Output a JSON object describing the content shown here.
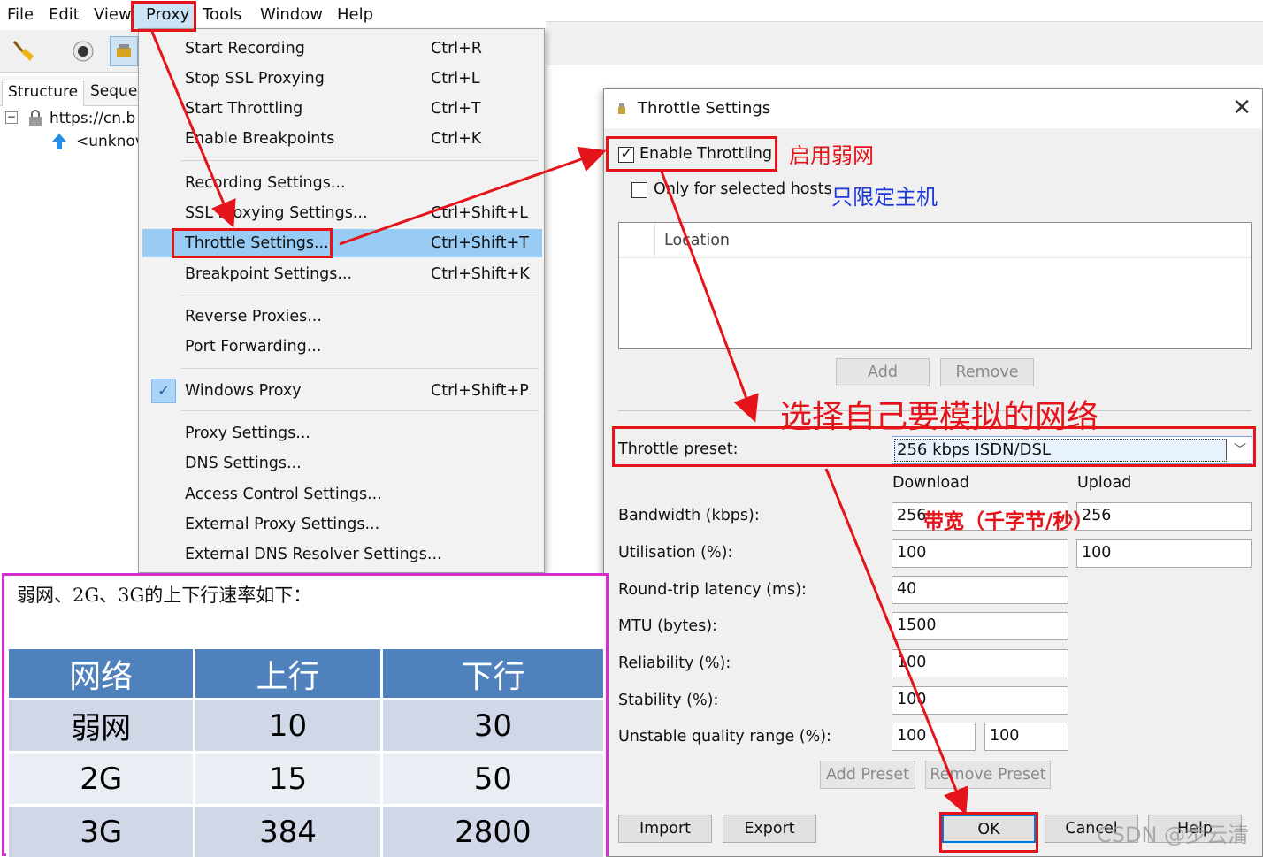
{
  "menubar": {
    "items": [
      "File",
      "Edit",
      "View",
      "Proxy",
      "Tools",
      "Window",
      "Help"
    ]
  },
  "left_panel": {
    "tabs": [
      "Structure",
      "Seque"
    ],
    "tree": [
      "https://cn.b",
      "<unknov"
    ]
  },
  "proxy_menu": {
    "items": [
      {
        "label": "Start Recording",
        "shortcut": "Ctrl+R"
      },
      {
        "label": "Stop SSL Proxying",
        "shortcut": "Ctrl+L"
      },
      {
        "label": "Start Throttling",
        "shortcut": "Ctrl+T"
      },
      {
        "label": "Enable Breakpoints",
        "shortcut": "Ctrl+K"
      },
      {
        "label": "Recording Settings...",
        "shortcut": ""
      },
      {
        "label": "SSL Proxying Settings...",
        "shortcut": "Ctrl+Shift+L"
      },
      {
        "label": "Throttle Settings...",
        "shortcut": "Ctrl+Shift+T"
      },
      {
        "label": "Breakpoint Settings...",
        "shortcut": "Ctrl+Shift+K"
      },
      {
        "label": "Reverse Proxies...",
        "shortcut": ""
      },
      {
        "label": "Port Forwarding...",
        "shortcut": ""
      },
      {
        "label": "Windows Proxy",
        "shortcut": "Ctrl+Shift+P"
      },
      {
        "label": "Proxy Settings...",
        "shortcut": ""
      },
      {
        "label": "DNS Settings...",
        "shortcut": ""
      },
      {
        "label": "Access Control Settings...",
        "shortcut": ""
      },
      {
        "label": "External Proxy Settings...",
        "shortcut": ""
      },
      {
        "label": "External DNS Resolver Settings...",
        "shortcut": ""
      }
    ]
  },
  "dialog": {
    "title": "Throttle Settings",
    "close": "✕",
    "enable_throttling": "Enable Throttling",
    "only_selected_hosts": "Only for selected hosts",
    "location_header": "Location",
    "add": "Add",
    "remove": "Remove",
    "preset_label": "Throttle preset:",
    "preset_value": "256 kbps ISDN/DSL",
    "download": "Download",
    "upload": "Upload",
    "rows": [
      {
        "label": "Bandwidth (kbps):",
        "down": "256",
        "up": "256"
      },
      {
        "label": "Utilisation (%):",
        "down": "100",
        "up": "100"
      },
      {
        "label": "Round-trip latency (ms):",
        "down": "40"
      },
      {
        "label": "MTU (bytes):",
        "down": "1500"
      },
      {
        "label": "Reliability (%):",
        "down": "100"
      },
      {
        "label": "Stability (%):",
        "down": "100"
      },
      {
        "label": "Unstable quality range (%):",
        "down": "100",
        "up": "100"
      }
    ],
    "add_preset": "Add Preset",
    "remove_preset": "Remove Preset",
    "import": "Import",
    "export": "Export",
    "ok": "OK",
    "cancel": "Cancel",
    "help": "Help"
  },
  "annotations": {
    "enable": "启用弱网",
    "hosts": "只限定主机",
    "choose": "选择自己要模拟的网络",
    "bandwidth": "带宽（千字节/秒）"
  },
  "speed_table": {
    "caption": "弱网、2G、3G的上下行速率如下：",
    "headers": [
      "网络",
      "上行",
      "下行"
    ],
    "rows": [
      [
        "弱网",
        "10",
        "30"
      ],
      [
        "2G",
        "15",
        "50"
      ],
      [
        "3G",
        "384",
        "2800"
      ]
    ]
  },
  "watermark": "CSDN @步云清",
  "colors": {
    "annotation_red": "#e5141b",
    "annotation_blue": "#1c39d6",
    "menu_highlight": "#99ccf5",
    "table_header": "#4f81bd",
    "table_border": "#d52ecf"
  }
}
